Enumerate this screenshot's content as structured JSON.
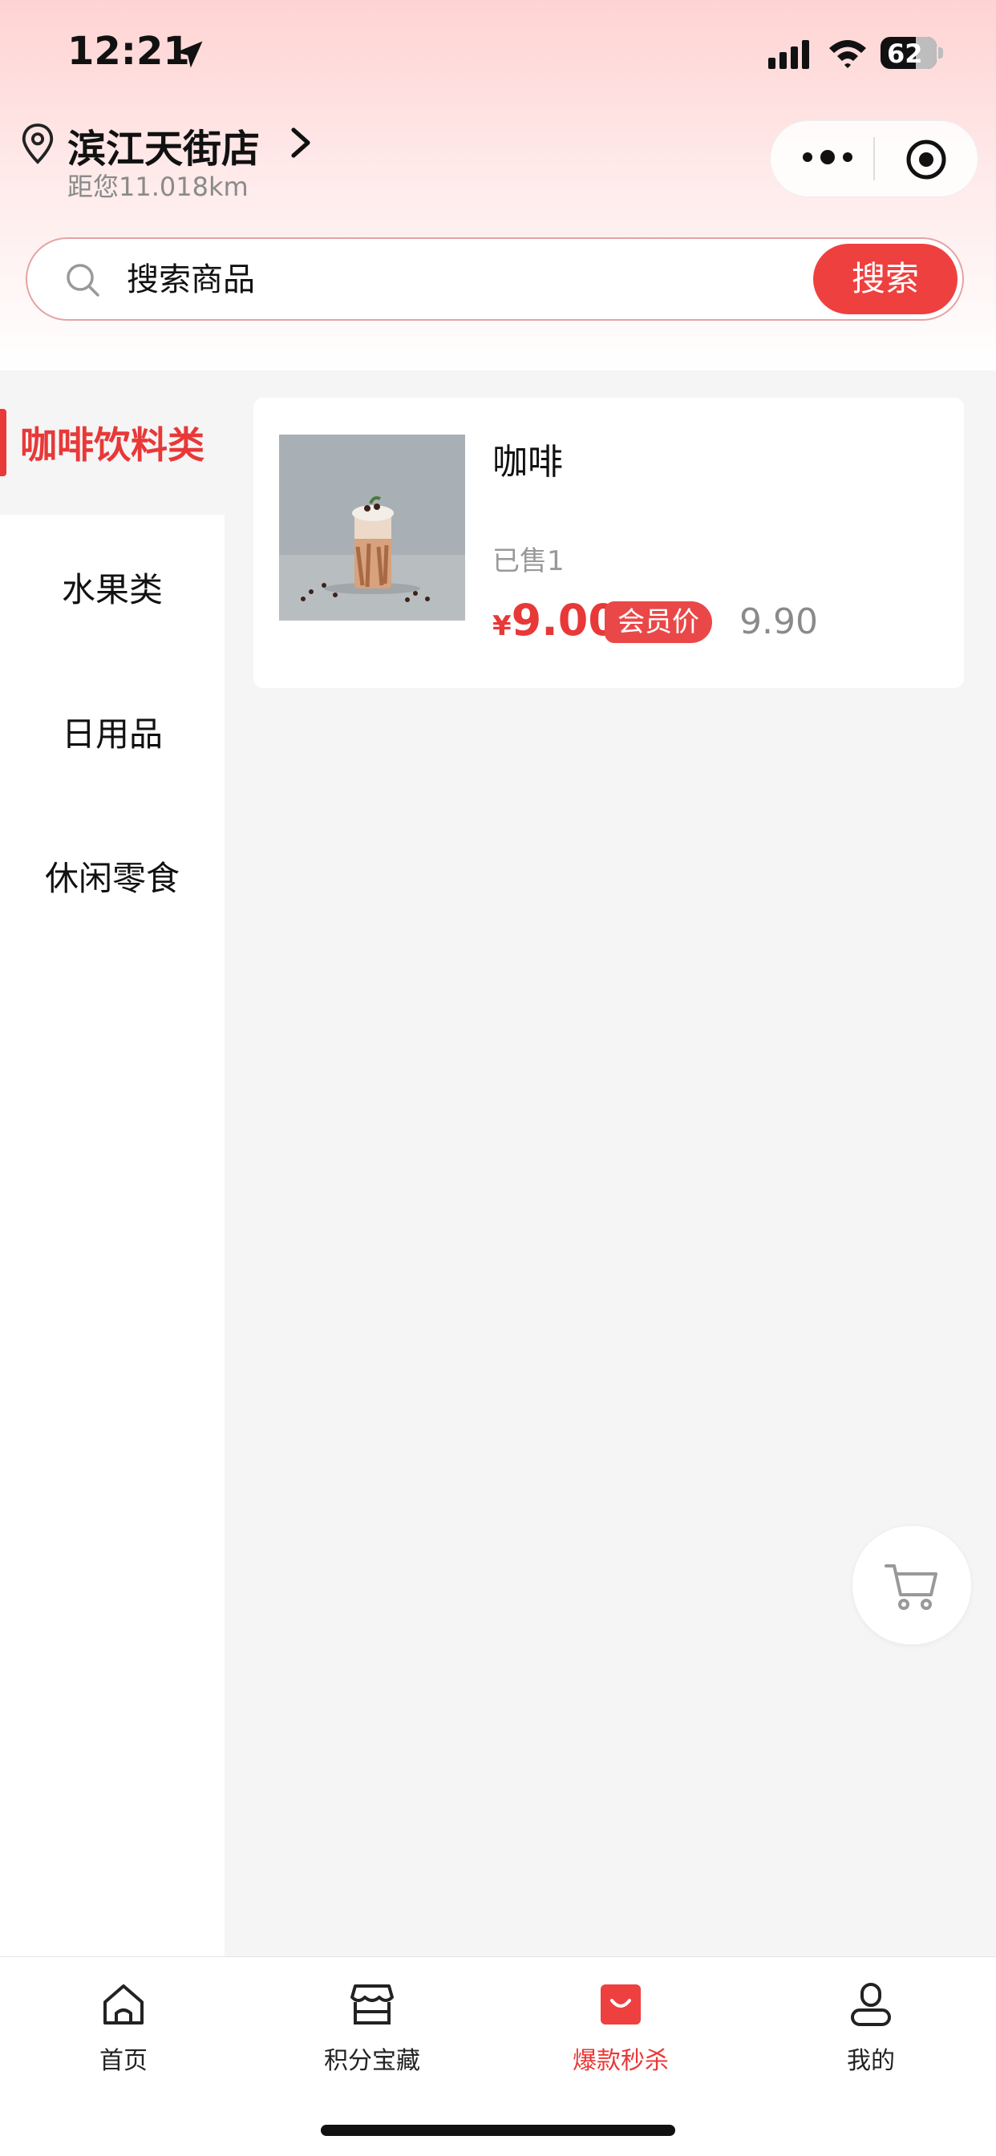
{
  "status_bar": {
    "time": "12:21",
    "battery": "62"
  },
  "store": {
    "name": "滨江天街店",
    "distance": "距您11.018km"
  },
  "search": {
    "placeholder": "搜索商品",
    "button_label": "搜索"
  },
  "categories": [
    {
      "label": "咖啡饮料类",
      "active": true
    },
    {
      "label": "水果类",
      "active": false
    },
    {
      "label": "日用品",
      "active": false
    },
    {
      "label": "休闲零食",
      "active": false
    }
  ],
  "products": [
    {
      "name": "咖啡",
      "sold": "已售1",
      "currency": "¥",
      "price": "9.00",
      "tag": "会员价",
      "original_price": "9.90"
    }
  ],
  "tabbar": {
    "items": [
      {
        "label": "首页",
        "icon": "home-icon",
        "active": false
      },
      {
        "label": "积分宝藏",
        "icon": "store-icon",
        "active": false
      },
      {
        "label": "爆款秒杀",
        "icon": "shopping-bag-icon",
        "active": true
      },
      {
        "label": "我的",
        "icon": "user-icon",
        "active": false
      }
    ]
  },
  "colors": {
    "accent": "#e83838",
    "search_button": "#ef4040",
    "background": "#f5f5f5"
  }
}
